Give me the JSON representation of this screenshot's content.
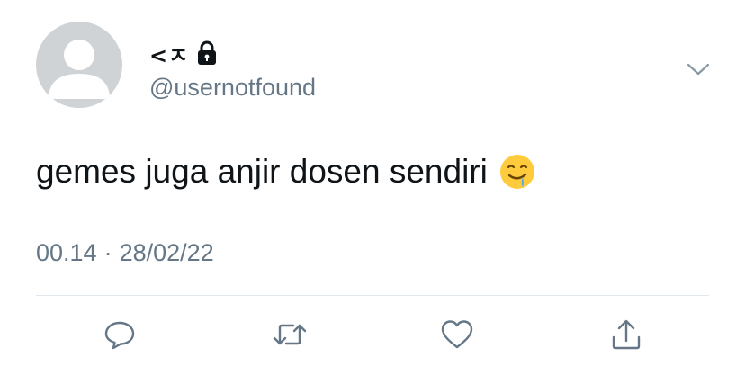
{
  "user": {
    "display_name": "<ㅈ",
    "username": "@usernotfound",
    "locked_icon": "lock-icon"
  },
  "tweet": {
    "text": "gemes juga anjir dosen sendiri",
    "emoji": "drooling-face-emoji",
    "time": "00.14",
    "separator": "·",
    "date": "28/02/22"
  },
  "actions": [
    "reply-icon",
    "retweet-icon",
    "like-icon",
    "share-icon"
  ],
  "colors": {
    "text_primary": "#0f1419",
    "text_secondary": "#657786",
    "icon": "#657786",
    "divider": "#e1e8ed",
    "avatar_bg": "#cfd3d6"
  }
}
